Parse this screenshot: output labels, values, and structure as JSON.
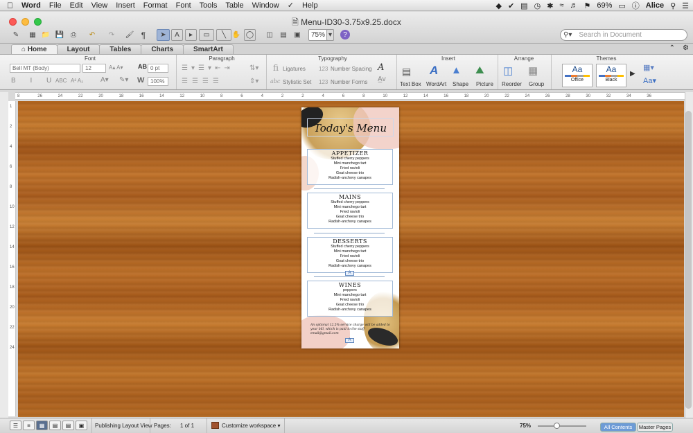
{
  "menubar": {
    "app": "Word",
    "items": [
      "File",
      "Edit",
      "View",
      "Insert",
      "Format",
      "Font",
      "Tools",
      "Table",
      "Window",
      "Help"
    ],
    "battery": "69%",
    "user": "Alice"
  },
  "window": {
    "title": "Menu-ID30-3.75x9.25.docx",
    "zoom": "75%",
    "search_placeholder": "Search in Document"
  },
  "tabs": [
    "Home",
    "Layout",
    "Tables",
    "Charts",
    "SmartArt"
  ],
  "ribbon": {
    "groups": [
      "Font",
      "Paragraph",
      "Typography",
      "Insert",
      "Arrange",
      "Themes"
    ],
    "font_name": "Bell MT (Body)",
    "font_size": "12",
    "spacing": "0 pt",
    "scale": "100%",
    "typography": {
      "ligatures": "Ligatures",
      "number_spacing": "Number Spacing",
      "stylistic_set": "Stylistic Set",
      "number_forms": "Number Forms"
    },
    "insert": [
      "Text Box",
      "WordArt",
      "Shape",
      "Picture"
    ],
    "arrange": [
      "Reorder",
      "Group"
    ],
    "themes": [
      "Office",
      "Black"
    ],
    "theme_sample": "Aa"
  },
  "document": {
    "title": "Today's Menu",
    "sections": [
      {
        "heading": "APPETIZER",
        "items": [
          "Stuffed cherry peppers",
          "Mini manchego tart",
          "Fried ravioli",
          "Goat cheese trio",
          "Radish-anchovy canapes"
        ]
      },
      {
        "heading": "MAINS",
        "items": [
          "Stuffed cherry peppers",
          "Mini manchego tart",
          "Fried ravioli",
          "Goat cheese trio",
          "Radish-anchovy canapes"
        ]
      },
      {
        "heading": "DESSERTS",
        "items": [
          "Stuffed cherry peppers",
          "Mini manchego tart",
          "Fried ravioli",
          "Goat cheese trio",
          "Radish-anchovy canapes"
        ]
      },
      {
        "heading": "WINES",
        "items": [
          "peppers",
          "Mini manchego tart",
          "Fried ravioli",
          "Goat cheese trio",
          "Radish-anchovy canapes"
        ]
      }
    ],
    "footnote": "An optional 12.5% service charge will be added to your bill, which is paid to the staff",
    "email": "email@gmail.com",
    "anchor": "A"
  },
  "ruler": {
    "h_ticks": [
      "8",
      "26",
      "24",
      "22",
      "20",
      "18",
      "16",
      "14",
      "12",
      "10",
      "8",
      "6",
      "4",
      "2",
      "2",
      "4",
      "6",
      "8",
      "10",
      "12",
      "14",
      "16",
      "18",
      "20",
      "22",
      "24",
      "26",
      "28",
      "30",
      "32",
      "34",
      "36"
    ],
    "v_ticks": [
      "1",
      "2",
      "4",
      "6",
      "8",
      "10",
      "12",
      "14",
      "16",
      "18",
      "20",
      "22",
      "24"
    ]
  },
  "status": {
    "view": "Publishing Layout View",
    "pages_label": "Pages:",
    "pages": "1 of 1",
    "workspace": "Customize workspace",
    "zoom": "75%",
    "all_contents": "All Contents",
    "master_pages": "Master Pages"
  }
}
